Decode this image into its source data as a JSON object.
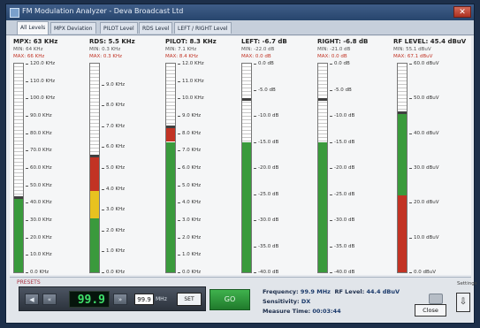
{
  "window": {
    "title": "FM Modulation Analyzer - Deva Broadcast Ltd"
  },
  "tabs": [
    "All Levels",
    "MPX Deviation",
    "PILOT Level",
    "RDS Level",
    "LEFT / RIGHT Level"
  ],
  "meters": [
    {
      "key": "mpx",
      "title": "MPX: 63 KHz",
      "min": "MIN: 64 KHz",
      "max": "MAX: 66 KHz",
      "scale_min": 0,
      "scale_max": 120,
      "level": 42,
      "peak": 43,
      "ticks": [
        {
          "v": 120,
          "t": "120.0 KHz"
        },
        {
          "v": 110,
          "t": "110.0 KHz"
        },
        {
          "v": 100,
          "t": "100.0 KHz"
        },
        {
          "v": 90,
          "t": "90.0 KHz"
        },
        {
          "v": 80,
          "t": "80.0 KHz"
        },
        {
          "v": 70,
          "t": "70.0 KHz"
        },
        {
          "v": 60,
          "t": "60.0 KHz"
        },
        {
          "v": 50,
          "t": "50.0 KHz"
        },
        {
          "v": 40,
          "t": "40.0 KHz"
        },
        {
          "v": 30,
          "t": "30.0 KHz"
        },
        {
          "v": 20,
          "t": "20.0 KHz"
        },
        {
          "v": 10,
          "t": "10.0 KHz"
        },
        {
          "v": 0,
          "t": "0.0 KHz"
        }
      ],
      "segments": [
        {
          "from": 0,
          "to": 42,
          "color": "#3a9a3c"
        }
      ]
    },
    {
      "key": "rds",
      "title": "RDS: 5.5 KHz",
      "min": "MIN: 0.3 KHz",
      "max": "MAX: 0.3 KHz",
      "scale_min": 0,
      "scale_max": 10,
      "level": 5.5,
      "peak": 5.6,
      "ticks": [
        {
          "v": 9,
          "t": "9.0 KHz"
        },
        {
          "v": 8,
          "t": "8.0 KHz"
        },
        {
          "v": 7,
          "t": "7.0 KHz"
        },
        {
          "v": 6,
          "t": "6.0 KHz"
        },
        {
          "v": 5,
          "t": "5.0 KHz"
        },
        {
          "v": 4,
          "t": "4.0 KHz"
        },
        {
          "v": 3,
          "t": "3.0 KHz"
        },
        {
          "v": 2,
          "t": "2.0 KHz"
        },
        {
          "v": 1,
          "t": "1.0 KHz"
        },
        {
          "v": 0,
          "t": "0.0 KHz"
        }
      ],
      "segments": [
        {
          "from": 0,
          "to": 2.6,
          "color": "#3a9a3c"
        },
        {
          "from": 2.6,
          "to": 3.9,
          "color": "#e8c21f"
        },
        {
          "from": 3.9,
          "to": 5.5,
          "color": "#c23324"
        }
      ]
    },
    {
      "key": "pilot",
      "title": "PILOT: 8.3 KHz",
      "min": "MIN: 7.1 KHz",
      "max": "MAX: 8.4 KHz",
      "scale_min": 0,
      "scale_max": 12,
      "level": 8.3,
      "peak": 8.4,
      "ticks": [
        {
          "v": 12,
          "t": "12.0 KHz"
        },
        {
          "v": 11,
          "t": "11.0 KHz"
        },
        {
          "v": 10,
          "t": "10.0 KHz"
        },
        {
          "v": 9,
          "t": "9.0 KHz"
        },
        {
          "v": 8,
          "t": "8.0 KHz"
        },
        {
          "v": 7,
          "t": "7.0 KHz"
        },
        {
          "v": 6,
          "t": "6.0 KHz"
        },
        {
          "v": 5,
          "t": "5.0 KHz"
        },
        {
          "v": 4,
          "t": "4.0 KHz"
        },
        {
          "v": 3,
          "t": "3.0 KHz"
        },
        {
          "v": 2,
          "t": "2.0 KHz"
        },
        {
          "v": 1,
          "t": "1.0 KHz"
        },
        {
          "v": 0,
          "t": "0.0 KHz"
        }
      ],
      "segments": [
        {
          "from": 0,
          "to": 7.5,
          "color": "#3a9a3c"
        },
        {
          "from": 7.5,
          "to": 8.3,
          "color": "#c23324"
        }
      ]
    },
    {
      "key": "left",
      "title": "LEFT: -6.7 dB",
      "min": "MIN: -22.0 dB",
      "max": "MAX: 0.0 dB",
      "scale_min": -40,
      "scale_max": 0,
      "level": -15,
      "peak": -6.7,
      "ticks": [
        {
          "v": 0,
          "t": "0.0 dB"
        },
        {
          "v": -5,
          "t": "-5.0 dB"
        },
        {
          "v": -10,
          "t": "-10.0 dB"
        },
        {
          "v": -15,
          "t": "-15.0 dB"
        },
        {
          "v": -20,
          "t": "-20.0 dB"
        },
        {
          "v": -25,
          "t": "-25.0 dB"
        },
        {
          "v": -30,
          "t": "-30.0 dB"
        },
        {
          "v": -35,
          "t": "-35.0 dB"
        },
        {
          "v": -40,
          "t": "-40.0 dB"
        }
      ],
      "segments": [
        {
          "from": -40,
          "to": -15,
          "color": "#3a9a3c"
        }
      ]
    },
    {
      "key": "right",
      "title": "RIGHT: -6.8 dB",
      "min": "MIN: -21.0 dB",
      "max": "MAX: 0.0 dB",
      "scale_min": -40,
      "scale_max": 0,
      "level": -15,
      "peak": -6.8,
      "ticks": [
        {
          "v": 0,
          "t": "0.0 dB"
        },
        {
          "v": -5,
          "t": "-5.0 dB"
        },
        {
          "v": -10,
          "t": "-10.0 dB"
        },
        {
          "v": -15,
          "t": "-15.0 dB"
        },
        {
          "v": -20,
          "t": "-20.0 dB"
        },
        {
          "v": -25,
          "t": "-25.0 dB"
        },
        {
          "v": -30,
          "t": "-30.0 dB"
        },
        {
          "v": -35,
          "t": "-35.0 dB"
        },
        {
          "v": -40,
          "t": "-40.0 dB"
        }
      ],
      "segments": [
        {
          "from": -40,
          "to": -15,
          "color": "#3a9a3c"
        }
      ]
    },
    {
      "key": "rf",
      "title": "RF LEVEL: 45.4 dBuV",
      "min": "MIN: 55.1 dBuV",
      "max": "MAX: 67.1 dBuV",
      "scale_min": 0,
      "scale_max": 60,
      "level": 45.4,
      "peak": 46,
      "ticks": [
        {
          "v": 60,
          "t": "60.0 dBuV"
        },
        {
          "v": 50,
          "t": "50.0 dBuV"
        },
        {
          "v": 40,
          "t": "40.0 dBuV"
        },
        {
          "v": 30,
          "t": "30.0 dBuV"
        },
        {
          "v": 20,
          "t": "20.0 dBuV"
        },
        {
          "v": 10,
          "t": "10.0 dBuV"
        },
        {
          "v": 0,
          "t": "0.0 dBuV"
        }
      ],
      "segments": [
        {
          "from": 0,
          "to": 22,
          "color": "#c23324"
        },
        {
          "from": 22,
          "to": 45.4,
          "color": "#3a9a3c"
        }
      ]
    }
  ],
  "bottom": {
    "preset_label": "PRESETS",
    "freq_display": "99.9",
    "freq_input": "99.9",
    "unit": "MHz",
    "set_label": "SET",
    "go_label": "GO",
    "frequency_label": "Frequency:",
    "frequency_value": "99.9 MHz",
    "rf_label": "RF Level:",
    "rf_value": "44.4 dBuV",
    "sensitivity_label": "Sensitivity:",
    "sensitivity_value": "DX",
    "time_label": "Measure Time:",
    "time_value": "00:03:44",
    "lock_label": "Settings",
    "close_label": "Close"
  }
}
